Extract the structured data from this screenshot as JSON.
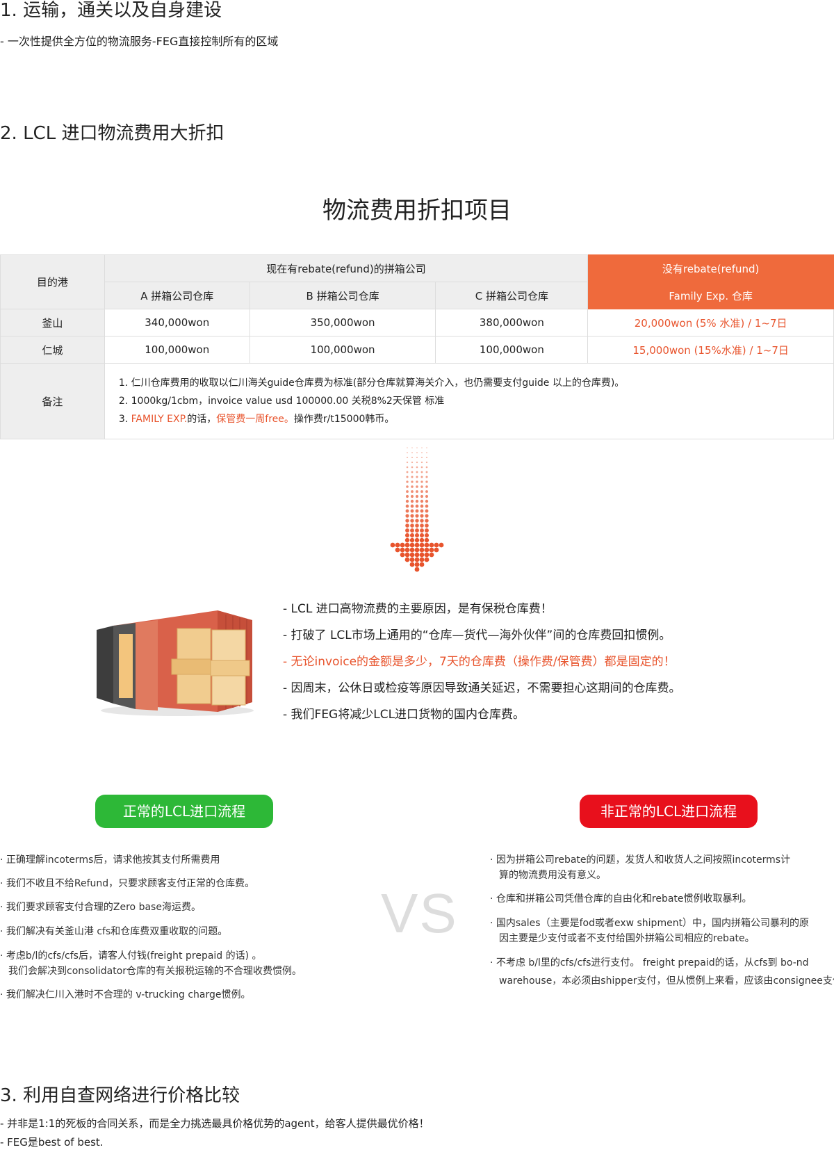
{
  "section1": {
    "title": "1. 运输，通关以及自身建设",
    "desc": "- 一次性提供全方位的物流服务-FEG直接控制所有的区域"
  },
  "section2": {
    "title": "2. LCL 进口物流费用大折扣",
    "table_title": "物流费用折扣项目",
    "table": {
      "dest_header": "目的港",
      "group_header": "现在有rebate(refund)的拼箱公司",
      "orange_header": "没有rebate(refund)",
      "col_a": "A 拼箱公司仓库",
      "col_b": "B 拼箱公司仓库",
      "col_c": "C 拼箱公司仓库",
      "col_family": "Family Exp. 仓库",
      "rows": [
        {
          "port": "釜山",
          "a": "340,000won",
          "b": "350,000won",
          "c": "380,000won",
          "family": "20,000won (5% 水准) / 1~7日"
        },
        {
          "port": "仁城",
          "a": "100,000won",
          "b": "100,000won",
          "c": "100,000won",
          "family": "15,000won (15%水准) / 1~7日"
        }
      ],
      "notes_label": "备注",
      "note1": "1. 仁川仓库费用的收取以仁川海关guide仓库费为标准(部分仓库就算海关介入，也仍需要支付guide 以上的仓库费)。",
      "note2": "2. 1000kg/1cbm，invoice value usd 100000.00 关税8%2天保管 标准",
      "note3_prefix": "3. ",
      "note3_hl1": "FAMILY EXP.",
      "note3_mid": "的话，",
      "note3_hl2": "保管费一周free。",
      "note3_suffix": "操作费r/t15000韩币。"
    }
  },
  "reasons": [
    "- LCL 进口高物流费的主要原因，是有保税仓库费！",
    "- 打破了 LCL市场上通用的“仓库—货代—海外伙伴”间的仓库费回扣惯例。",
    "- 无论invoice的金额是多少，7天的仓库费（操作费/保管费）都是固定的！",
    "- 因周末，公休日或检疫等原因导致通关延迟，不需要担心这期间的仓库费。",
    "- 我们FEG将减少LCL进口货物的国内仓库费。"
  ],
  "compare": {
    "normal_label": "正常的LCL进口流程",
    "abnormal_label": "非正常的LCL进口流程",
    "vs": "VS",
    "normal_items": [
      "· 正确理解incoterms后，请求他按其支付所需费用",
      "· 我们不收且不给Refund，只要求顾客支付正常的仓库费。",
      "· 我们要求顾客支付合理的Zero base海运费。",
      "· 我们解决有关釜山港 cfs和仓库费双重收取的问题。",
      "· 考虑b/l的cfs/cfs后，请客人付钱(freight prepaid 的话) 。",
      "  我们会解决到consolidator仓库的有关报税运输的不合理收费惯例。",
      "· 我们解决仁川入港时不合理的 v-trucking charge惯例。"
    ],
    "abnormal_items": [
      "· 因为拼箱公司rebate的问题，发货人和收货人之间按照incoterms计",
      "  算的物流费用没有意义。",
      "· 仓库和拼箱公司凭借仓库的自由化和rebate惯例收取暴利。",
      "· 国内sales（主要是fod或者exw shipment）中，国内拼箱公司暴利的原",
      "  因主要是少支付或者不支付给国外拼箱公司相应的rebate。",
      "· 不考虑 b/l里的cfs/cfs进行支付。 freight prepaid的话，从cfs到 bo-nd",
      "  warehouse，本必须由shipper支付，但从惯例上来看，应该由consignee支付"
    ]
  },
  "section3": {
    "title": "3. 利用自查网络进行价格比较",
    "line1": "- 并非是1:1的死板的合同关系，而是全力挑选最具价格优势的agent，给客人提供最优价格！",
    "line2": "- FEG是best of best."
  },
  "colors": {
    "orange": "#ef6a3c",
    "green": "#2db837",
    "red": "#e8101c",
    "vs_gray": "#dddddd"
  }
}
